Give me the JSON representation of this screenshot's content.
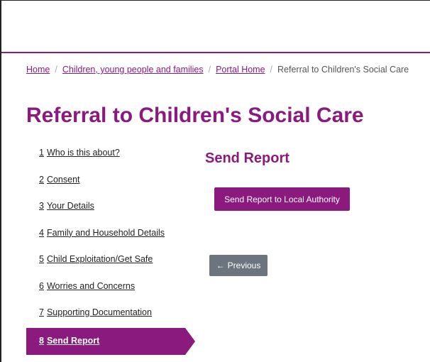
{
  "breadcrumb": {
    "items": [
      "Home",
      "Children, young people and families",
      "Portal Home"
    ],
    "current": "Referral to Children's Social Care",
    "separator": "/"
  },
  "page": {
    "title": "Referral to Children's Social Care"
  },
  "steps": [
    {
      "num": "1",
      "label": "Who is this about?"
    },
    {
      "num": "2",
      "label": "Consent"
    },
    {
      "num": "3",
      "label": "Your Details"
    },
    {
      "num": "4",
      "label": "Family and Household Details"
    },
    {
      "num": "5",
      "label": "Child Exploitation/Get Safe"
    },
    {
      "num": "6",
      "label": "Worries and Concerns"
    },
    {
      "num": "7",
      "label": "Supporting Documentation"
    },
    {
      "num": "8",
      "label": "Send Report"
    }
  ],
  "main": {
    "heading": "Send Report",
    "send_button": "Send Report to Local Authority",
    "previous_button": "Previous",
    "previous_icon": "←"
  },
  "colors": {
    "brand": "#8b1a7f",
    "secondary_button": "#6c757d"
  }
}
